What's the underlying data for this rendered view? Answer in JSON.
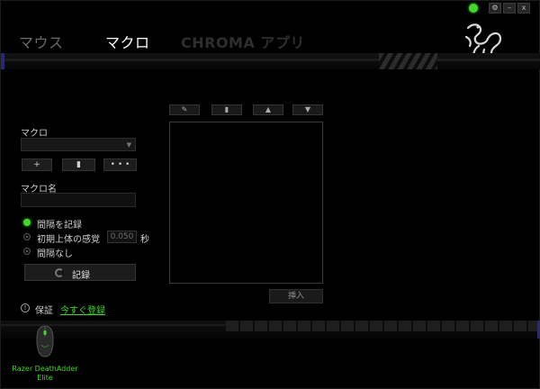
{
  "window_controls": {
    "settings": "⚙",
    "minimize": "–",
    "close": "x"
  },
  "tabs": [
    {
      "label": "マウス",
      "active": false
    },
    {
      "label": "マクロ",
      "active": true
    },
    {
      "label": "CHROMA アプリ",
      "active": false
    }
  ],
  "macro_panel": {
    "macro_label": "マクロ",
    "macro_select_value": "",
    "add_button": "+",
    "delete_button": "▮",
    "more_button": "• • •",
    "macro_name_label": "マクロ名",
    "macro_name_value": "",
    "record_options": [
      {
        "label": "間隔を記録",
        "selected": true
      },
      {
        "label": "初期上体の感覚",
        "selected": false,
        "delay_value": "0.050",
        "unit": "秒"
      },
      {
        "label": "間隔なし",
        "selected": false
      }
    ],
    "record_button": "記録"
  },
  "events_panel": {
    "edit_button": "✎",
    "delete_button": "▮",
    "move_up_button": "▲",
    "move_down_button": "▼",
    "insert_button": "挿入"
  },
  "footer": {
    "warranty_icon": "!",
    "warranty_label": "保証",
    "register_link": "今すぐ登録"
  },
  "devices": [
    {
      "name": "Razer DeathAdder Elite"
    }
  ],
  "colors": {
    "accent": "#44d62c",
    "background": "#000000",
    "panel": "#1c1c1c"
  }
}
